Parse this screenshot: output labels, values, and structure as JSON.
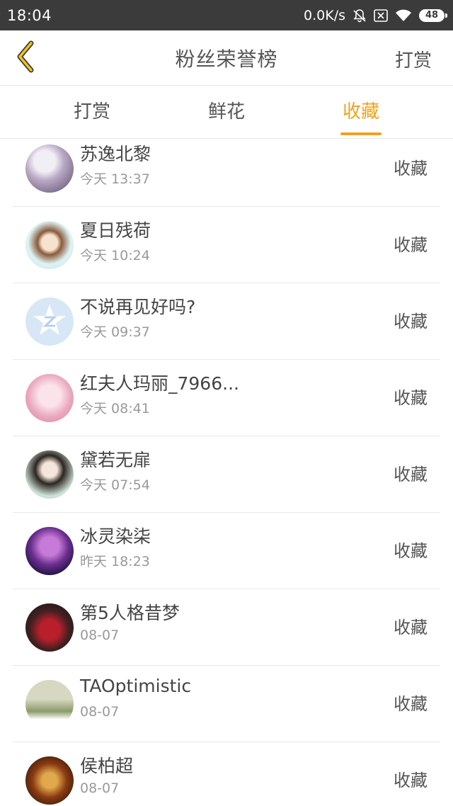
{
  "status_bar": {
    "time": "18:04",
    "network_speed": "0.0K/s",
    "battery": "48",
    "icons": [
      "mute-bell-icon",
      "sim-off-icon",
      "wifi-icon",
      "battery-icon"
    ]
  },
  "navbar": {
    "back_icon": "chevron-left-icon",
    "title": "粉丝荣誉榜",
    "right_action": "打赏"
  },
  "tabs": [
    {
      "label": "打赏",
      "active": false
    },
    {
      "label": "鲜花",
      "active": false
    },
    {
      "label": "收藏",
      "active": true
    }
  ],
  "colors": {
    "accent": "#f3a21a",
    "status_bar": "#3b3b3b"
  },
  "rows": [
    {
      "name": "苏逸北黎",
      "time": "今天 13:37",
      "action": "收藏"
    },
    {
      "name": "夏日残荷",
      "time": "今天 10:24",
      "action": "收藏"
    },
    {
      "name": "不说再见好吗?",
      "time": "今天 09:37",
      "action": "收藏"
    },
    {
      "name": "红夫人玛丽_7966...",
      "time": "今天 08:41",
      "action": "收藏"
    },
    {
      "name": "黛若无扉",
      "time": "今天 07:54",
      "action": "收藏"
    },
    {
      "name": "冰灵染柒",
      "time": "昨天 18:23",
      "action": "收藏"
    },
    {
      "name": "第5人格昔梦",
      "time": "08-07",
      "action": "收藏"
    },
    {
      "name": "TAOptimistic",
      "time": "08-07",
      "action": "收藏"
    },
    {
      "name": "侯柏超",
      "time": "08-07",
      "action": "收藏"
    }
  ]
}
